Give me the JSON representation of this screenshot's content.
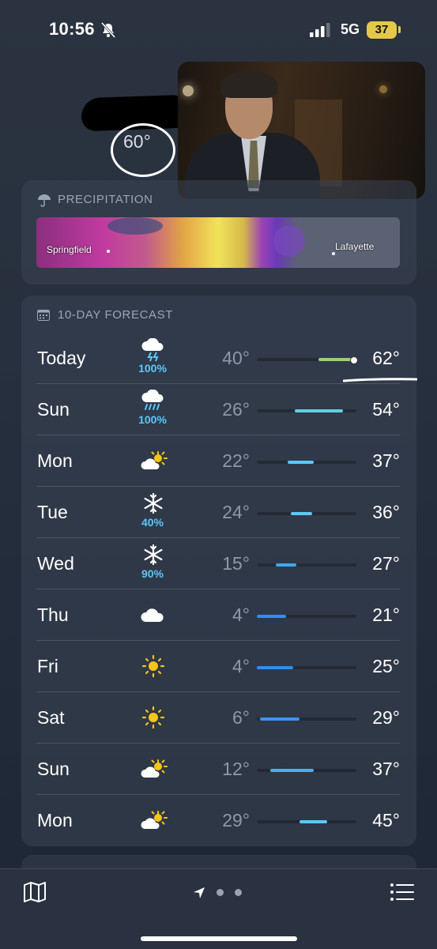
{
  "status_bar": {
    "time": "10:56",
    "network": "5G",
    "battery": "37"
  },
  "header": {
    "temperature": "60°"
  },
  "precipitation": {
    "title": "PRECIPITATION",
    "map_labels": [
      "Springfield",
      "Lafayette"
    ]
  },
  "forecast": {
    "title": "10-DAY FORECAST",
    "range_min": 4,
    "range_max": 62,
    "days": [
      {
        "day": "Today",
        "icon": "thunderstorm-icon",
        "precip": "100%",
        "low": "40°",
        "high": "62°",
        "low_val": 40,
        "high_val": 62,
        "current_val": 60,
        "color": "#9ccf74"
      },
      {
        "day": "Sun",
        "icon": "heavy-rain-icon",
        "precip": "100%",
        "low": "26°",
        "high": "54°",
        "low_val": 26,
        "high_val": 54,
        "color": "#5fd0e0"
      },
      {
        "day": "Mon",
        "icon": "partly-sunny-icon",
        "precip": "",
        "low": "22°",
        "high": "37°",
        "low_val": 22,
        "high_val": 37,
        "color": "#5ac8fa"
      },
      {
        "day": "Tue",
        "icon": "snow-icon",
        "precip": "40%",
        "low": "24°",
        "high": "36°",
        "low_val": 24,
        "high_val": 36,
        "color": "#5ac8fa"
      },
      {
        "day": "Wed",
        "icon": "snow-icon",
        "precip": "90%",
        "low": "15°",
        "high": "27°",
        "low_val": 15,
        "high_val": 27,
        "color": "#3fa7f0"
      },
      {
        "day": "Thu",
        "icon": "cloud-icon",
        "precip": "",
        "low": "4°",
        "high": "21°",
        "low_val": 4,
        "high_val": 21,
        "color": "#2f8ff0"
      },
      {
        "day": "Fri",
        "icon": "sun-icon",
        "precip": "",
        "low": "4°",
        "high": "25°",
        "low_val": 4,
        "high_val": 25,
        "color": "#2f8ff0"
      },
      {
        "day": "Sat",
        "icon": "sun-icon",
        "precip": "",
        "low": "6°",
        "high": "29°",
        "low_val": 6,
        "high_val": 29,
        "color": "#3a96f2"
      },
      {
        "day": "Sun",
        "icon": "partly-sunny-icon",
        "precip": "",
        "low": "12°",
        "high": "37°",
        "low_val": 12,
        "high_val": 37,
        "color": "#4aaef4"
      },
      {
        "day": "Mon",
        "icon": "partly-sunny-icon",
        "precip": "",
        "low": "29°",
        "high": "45°",
        "low_val": 29,
        "high_val": 45,
        "color": "#5ac8fa"
      }
    ]
  },
  "colors": {
    "accent": "#5ac8fa",
    "battery": "#e5c84a"
  }
}
